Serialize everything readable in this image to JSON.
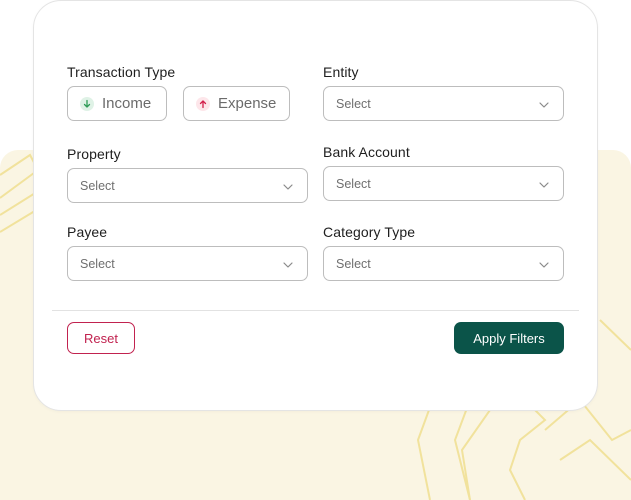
{
  "filters": {
    "transaction_type": {
      "label": "Transaction Type",
      "options": [
        {
          "label": "Income",
          "icon": "arrow-down-icon",
          "color": "#2e9b57"
        },
        {
          "label": "Expense",
          "icon": "arrow-up-icon",
          "color": "#d21f4b"
        }
      ]
    },
    "entity": {
      "label": "Entity",
      "value": "Select"
    },
    "property": {
      "label": "Property",
      "value": "Select"
    },
    "bank_account": {
      "label": "Bank Account",
      "value": "Select"
    },
    "payee": {
      "label": "Payee",
      "value": "Select"
    },
    "category_type": {
      "label": "Category Type",
      "value": "Select"
    }
  },
  "actions": {
    "reset_label": "Reset",
    "apply_label": "Apply Filters"
  },
  "colors": {
    "primary": "#0b5449",
    "danger": "#c1224f",
    "background_accent": "#faf5e3"
  }
}
